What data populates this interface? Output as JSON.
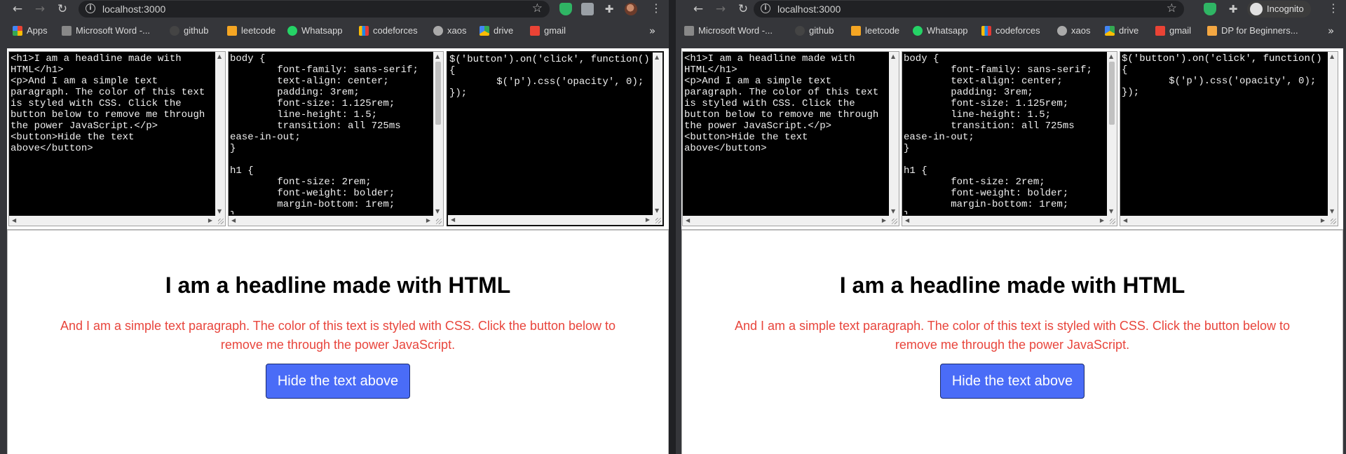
{
  "browser": {
    "url": "localhost:3000",
    "incognito_label": "Incognito"
  },
  "bookmarks_left": [
    {
      "label": "Apps",
      "icon": "apps-grid-icon",
      "color": "#4285f4"
    },
    {
      "label": "Microsoft Word -...",
      "icon": "document-icon",
      "color": "#888888"
    },
    {
      "label": "github",
      "icon": "github-icon",
      "color": "#444444"
    },
    {
      "label": "leetcode",
      "icon": "leetcode-icon",
      "color": "#f5a623"
    },
    {
      "label": "Whatsapp",
      "icon": "whatsapp-icon",
      "color": "#25d366"
    },
    {
      "label": "codeforces",
      "icon": "codeforces-icon",
      "color": "#1e88e5"
    },
    {
      "label": "xaos",
      "icon": "globe-icon",
      "color": "#aaaaaa"
    },
    {
      "label": "drive",
      "icon": "drive-icon",
      "color": "#fbbc05"
    },
    {
      "label": "gmail",
      "icon": "gmail-icon",
      "color": "#ea4335"
    }
  ],
  "bookmarks_right": [
    {
      "label": "Microsoft Word -...",
      "icon": "document-icon",
      "color": "#888888"
    },
    {
      "label": "github",
      "icon": "github-icon",
      "color": "#444444"
    },
    {
      "label": "leetcode",
      "icon": "leetcode-icon",
      "color": "#f5a623"
    },
    {
      "label": "Whatsapp",
      "icon": "whatsapp-icon",
      "color": "#25d366"
    },
    {
      "label": "codeforces",
      "icon": "codeforces-icon",
      "color": "#1e88e5"
    },
    {
      "label": "xaos",
      "icon": "globe-icon",
      "color": "#aaaaaa"
    },
    {
      "label": "drive",
      "icon": "drive-icon",
      "color": "#fbbc05"
    },
    {
      "label": "gmail",
      "icon": "gmail-icon",
      "color": "#ea4335"
    },
    {
      "label": "DP for Beginners...",
      "icon": "bookmark-icon",
      "color": "#f4a742"
    }
  ],
  "editors": {
    "html": "<h1>I am a headline made with\nHTML</h1>\n<p>And I am a simple text\nparagraph. The color of this text\nis styled with CSS. Click the\nbutton below to remove me through\nthe power JavaScript.</p>\n<button>Hide the text\nabove</button>",
    "css": "body {\n        font-family: sans-serif;\n        text-align: center;\n        padding: 3rem;\n        font-size: 1.125rem;\n        line-height: 1.5;\n        transition: all 725ms\nease-in-out;\n}\n\nh1 {\n        font-size: 2rem;\n        font-weight: bolder;\n        margin-bottom: 1rem;\n}",
    "js": "$('button').on('click', function()\n{\n        $('p').css('opacity', 0);\n});"
  },
  "preview": {
    "headline": "I am a headline made with HTML",
    "paragraph": "And I am a simple text paragraph. The color of this text is styled with CSS. Click the button below to remove me through the power JavaScript.",
    "button": "Hide the text above"
  }
}
